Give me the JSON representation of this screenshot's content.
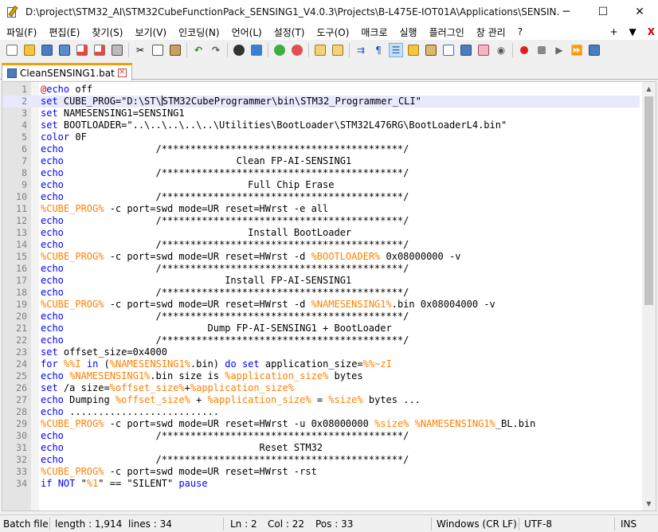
{
  "window": {
    "title": "D:\\project\\STM32_AI\\STM32CubeFunctionPack_SENSING1_V4.0.3\\Projects\\B-L475E-IOT01A\\Applications\\SENSIN...",
    "minimize": "─",
    "maximize": "☐",
    "close": "✕"
  },
  "menu": {
    "items": [
      "파일(F)",
      "편집(E)",
      "찾기(S)",
      "보기(V)",
      "인코딩(N)",
      "언어(L)",
      "설정(T)",
      "도구(O)",
      "매크로",
      "실행",
      "플러그인",
      "창 관리",
      "?"
    ],
    "right_plus": "+",
    "right_down": "▼",
    "right_close": "X"
  },
  "toolbar": {
    "icons": [
      "new-file-icon",
      "open-file-icon",
      "save-icon",
      "save-all-icon",
      "close-icon",
      "close-all-icon",
      "print-icon",
      "cut-icon",
      "copy-icon",
      "paste-icon",
      "undo-icon",
      "redo-icon",
      "find-icon",
      "replace-icon",
      "zoom-in-icon",
      "zoom-out-icon",
      "sync-vertical-icon",
      "sync-horizontal-icon",
      "word-wrap-icon",
      "show-all-chars-icon",
      "indent-guide-icon",
      "user-lang-icon",
      "doc-map-icon",
      "function-list-icon",
      "folder-workspace-icon",
      "monitoring-icon",
      "record-macro-icon",
      "stop-macro-icon",
      "play-macro-icon",
      "run-macro-multiple-icon",
      "save-macro-icon"
    ]
  },
  "tab": {
    "label": "CleanSENSING1.bat"
  },
  "editor": {
    "current_line": 2,
    "lines": [
      "@echo off",
      "set CUBE_PROG=\"D:\\ST\\STM32CubeProgrammer\\bin\\STM32_Programmer_CLI\"",
      "set NAMESENSING1=SENSING1",
      "set BOOTLOADER=\"..\\..\\..\\..\\..\\Utilities\\BootLoader\\STM32L476RG\\BootLoaderL4.bin\"",
      "color 0F",
      "echo                /******************************************/",
      "echo                              Clean FP-AI-SENSING1",
      "echo                /******************************************/",
      "echo                                Full Chip Erase",
      "echo                /******************************************/",
      "%CUBE_PROG% -c port=swd mode=UR reset=HWrst -e all",
      "echo                /******************************************/",
      "echo                                Install BootLoader",
      "echo                /******************************************/",
      "%CUBE_PROG% -c port=swd mode=UR reset=HWrst -d %BOOTLOADER% 0x08000000 -v",
      "echo                /******************************************/",
      "echo                            Install FP-AI-SENSING1",
      "echo                /******************************************/",
      "%CUBE_PROG% -c port=swd mode=UR reset=HWrst -d %NAMESENSING1%.bin 0x08004000 -v",
      "echo                /******************************************/",
      "echo                         Dump FP-AI-SENSING1 + BootLoader",
      "echo                /******************************************/",
      "set offset_size=0x4000",
      "for %%I in (%NAMESENSING1%.bin) do set application_size=%%~zI",
      "echo %NAMESENSING1%.bin size is %application_size% bytes",
      "set /a size=%offset_size%+%application_size%",
      "echo Dumping %offset_size% + %application_size% = %size% bytes ...",
      "echo ..........................",
      "%CUBE_PROG% -c port=swd mode=UR reset=HWrst -u 0x08000000 %size% %NAMESENSING1%_BL.bin",
      "echo                /******************************************/",
      "echo                                  Reset STM32",
      "echo                /******************************************/",
      "%CUBE_PROG% -c port=swd mode=UR reset=HWrst -rst",
      "if NOT \"%1\" == \"SILENT\" pause"
    ]
  },
  "status": {
    "type": "Batch file",
    "length": "length : 1,914",
    "lines": "lines : 34",
    "ln": "Ln : 2",
    "col": "Col : 22",
    "pos": "Pos : 33",
    "eol": "Windows (CR LF)",
    "encoding": "UTF-8",
    "ins": "INS"
  },
  "colors": {
    "keyword": "#0000ff",
    "variable": "#ff8000",
    "echo_keyword": "#cc0000",
    "tab_accent": "#f29f05"
  }
}
